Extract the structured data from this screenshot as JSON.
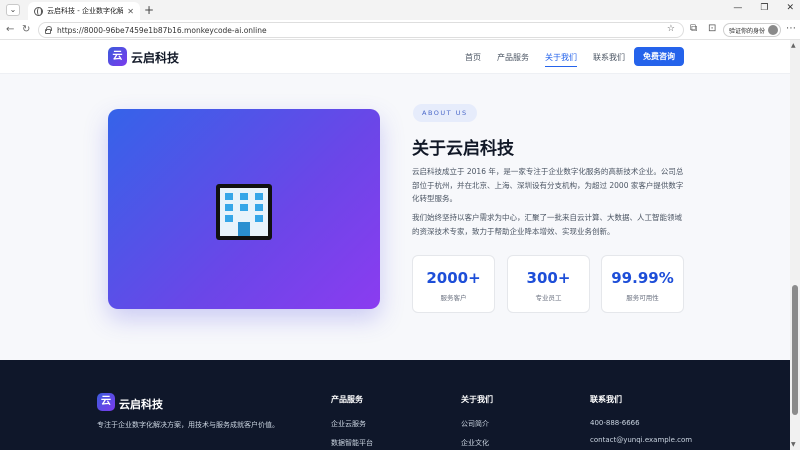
{
  "browser": {
    "tab_title": "云启科技 - 企业数字化解决方案服务",
    "tab_close": "✕",
    "new_tab": "+",
    "url": "https://8000-96be7459e1b87b16.monkeycode-ai.online",
    "profile_label": "验证你的身份"
  },
  "header": {
    "logo_char": "云",
    "logo_text": "云启科技",
    "nav": [
      {
        "label": "首页"
      },
      {
        "label": "产品服务"
      },
      {
        "label": "关于我们",
        "active": true
      },
      {
        "label": "联系我们"
      }
    ],
    "cta_label": "免费咨询"
  },
  "about": {
    "badge": "ABOUT US",
    "title": "关于云启科技",
    "paragraph1": "云启科技成立于 2016 年，是一家专注于企业数字化服务的高新技术企业。公司总部位于杭州，并在北京、上海、深圳设有分支机构，为超过 2000 家客户提供数字化转型服务。",
    "paragraph2": "我们始终坚持以客户需求为中心，汇聚了一批来自云计算、大数据、人工智能领域的资深技术专家，致力于帮助企业降本增效、实现业务创新。",
    "stats": [
      {
        "value": "2000+",
        "label": "服务客户"
      },
      {
        "value": "300+",
        "label": "专业员工"
      },
      {
        "value": "99.99%",
        "label": "服务可用性"
      }
    ],
    "hero_icon": "office-building-icon"
  },
  "footer": {
    "logo_char": "云",
    "logo_text": "云启科技",
    "tagline": "专注于企业数字化解决方案，用技术与服务成就客户价值。",
    "columns": [
      {
        "title": "产品服务",
        "links": [
          "企业云服务",
          "数据智能平台"
        ]
      },
      {
        "title": "关于我们",
        "links": [
          "公司简介",
          "企业文化"
        ]
      },
      {
        "title": "联系我们",
        "links": [
          "400-888-6666",
          "contact@yunqi.example.com"
        ]
      }
    ]
  },
  "colors": {
    "primary": "#2563eb",
    "footer_bg": "#0f172a",
    "hero_gradient_start": "#3563e9",
    "hero_gradient_end": "#8b3cf0"
  }
}
